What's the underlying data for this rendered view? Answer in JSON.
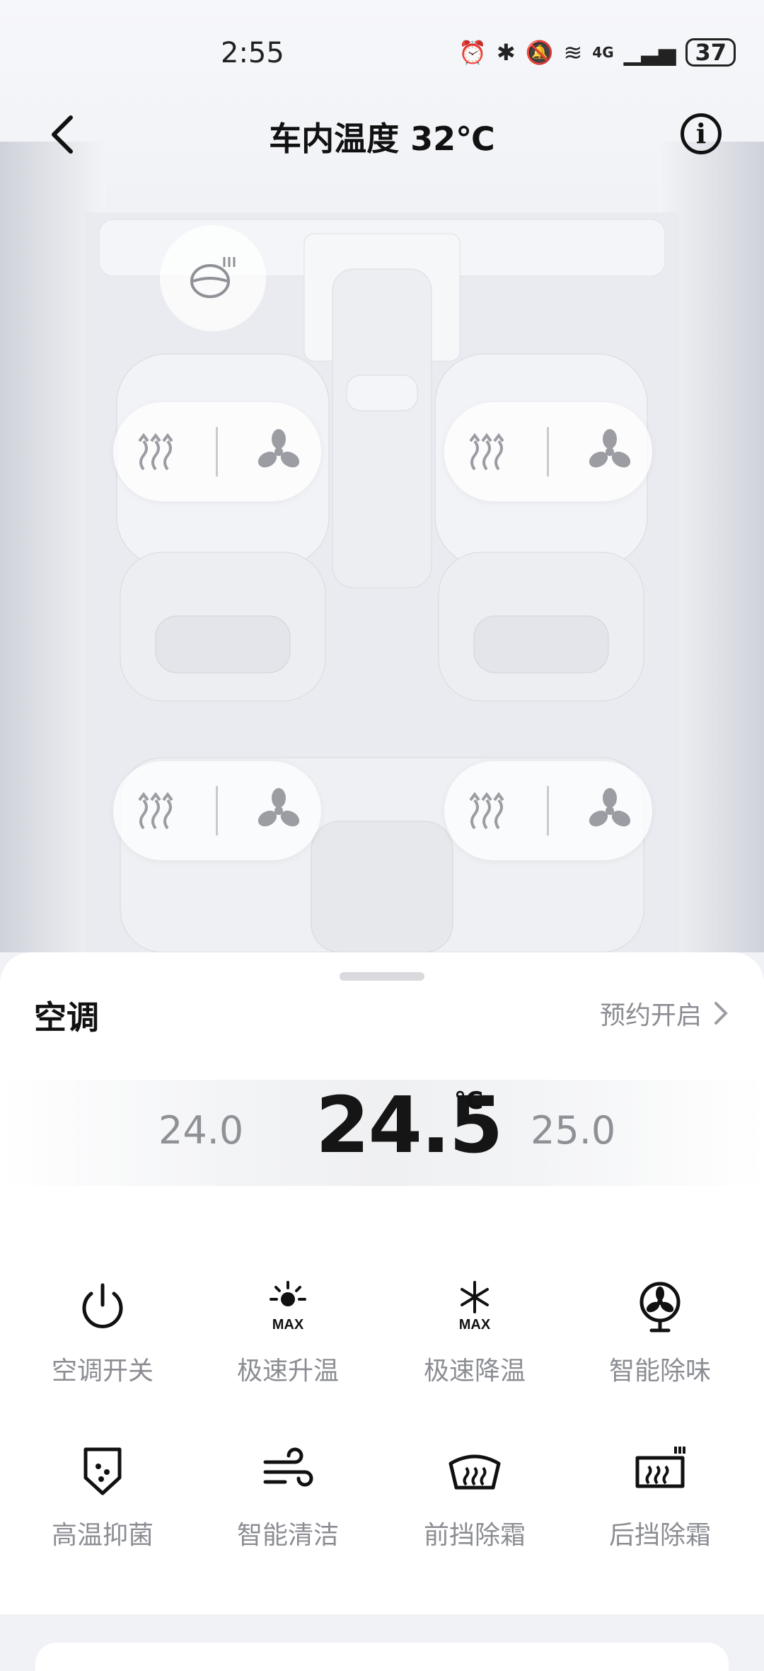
{
  "status": {
    "time": "2:55",
    "battery": "37",
    "network": "4G"
  },
  "header": {
    "title": "车内温度 32℃"
  },
  "panel": {
    "title": "空调",
    "schedule_label": "预约开启",
    "temp_left": "24.0",
    "temp_current": "24.5",
    "temp_unit": "℃",
    "temp_right": "25.0"
  },
  "controls": [
    {
      "label": "空调开关",
      "icon": "power-icon"
    },
    {
      "label": "极速升温",
      "icon": "sun-max-icon",
      "badge": "MAX"
    },
    {
      "label": "极速降温",
      "icon": "snowflake-max-icon",
      "badge": "MAX"
    },
    {
      "label": "智能除味",
      "icon": "fan-icon"
    },
    {
      "label": "高温抑菌",
      "icon": "shield-icon"
    },
    {
      "label": "智能清洁",
      "icon": "wind-icon"
    },
    {
      "label": "前挡除霜",
      "icon": "front-defrost-icon"
    },
    {
      "label": "后挡除霜",
      "icon": "rear-defrost-icon"
    }
  ]
}
